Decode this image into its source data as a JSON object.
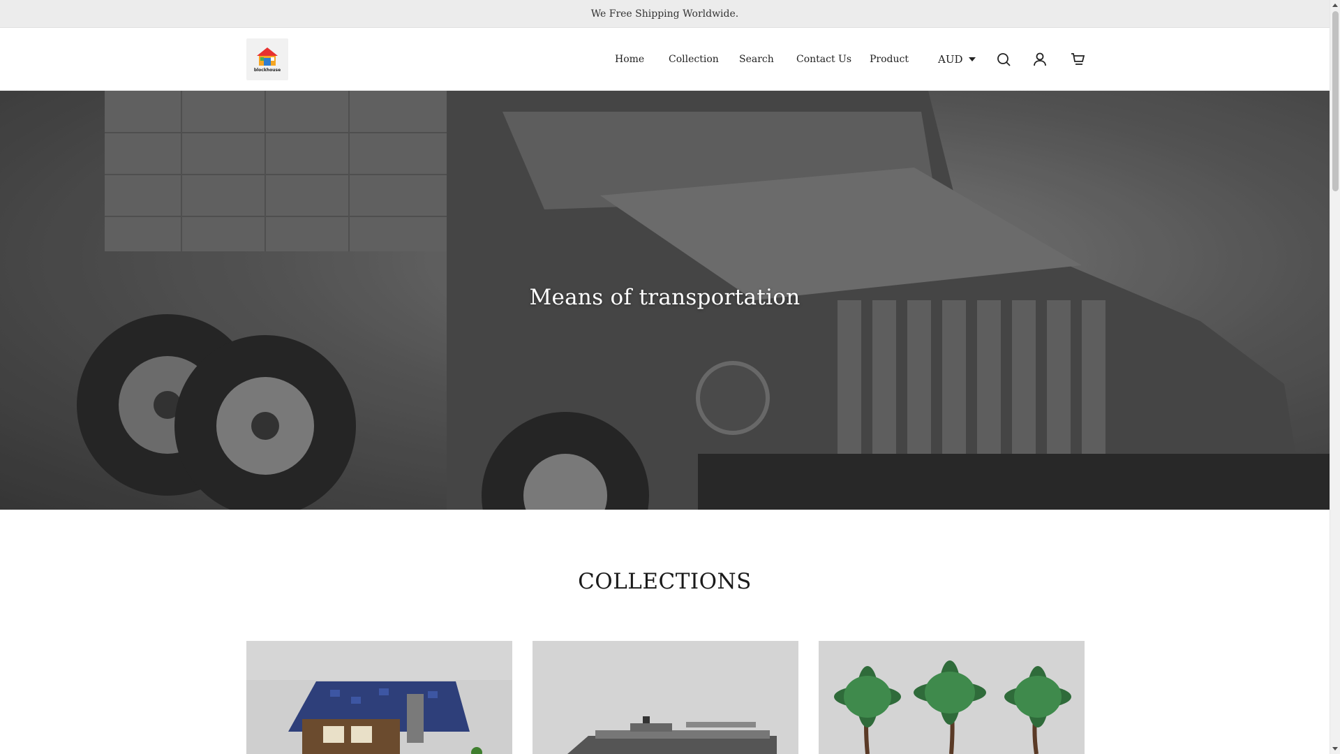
{
  "announcement": {
    "text": "We Free Shipping Worldwide."
  },
  "header": {
    "logo_text": "blockhouse",
    "nav": [
      {
        "label": "Home"
      },
      {
        "label": "Collection"
      },
      {
        "label": "Search"
      },
      {
        "label": "Contact Us"
      },
      {
        "label": "Product"
      }
    ],
    "currency": {
      "selected": "AUD"
    },
    "icons": [
      "search-icon",
      "account-icon",
      "cart-icon"
    ]
  },
  "hero": {
    "title": "Means of transportation"
  },
  "collections": {
    "title": "COLLECTIONS",
    "cards": [
      {
        "image": "medieval-house-image"
      },
      {
        "image": "ship-image"
      },
      {
        "image": "palm-trees-image"
      }
    ]
  },
  "colors": {
    "announcement_bg": "#ececec",
    "text": "#222222",
    "hero_overlay": "#5f5f5f"
  }
}
